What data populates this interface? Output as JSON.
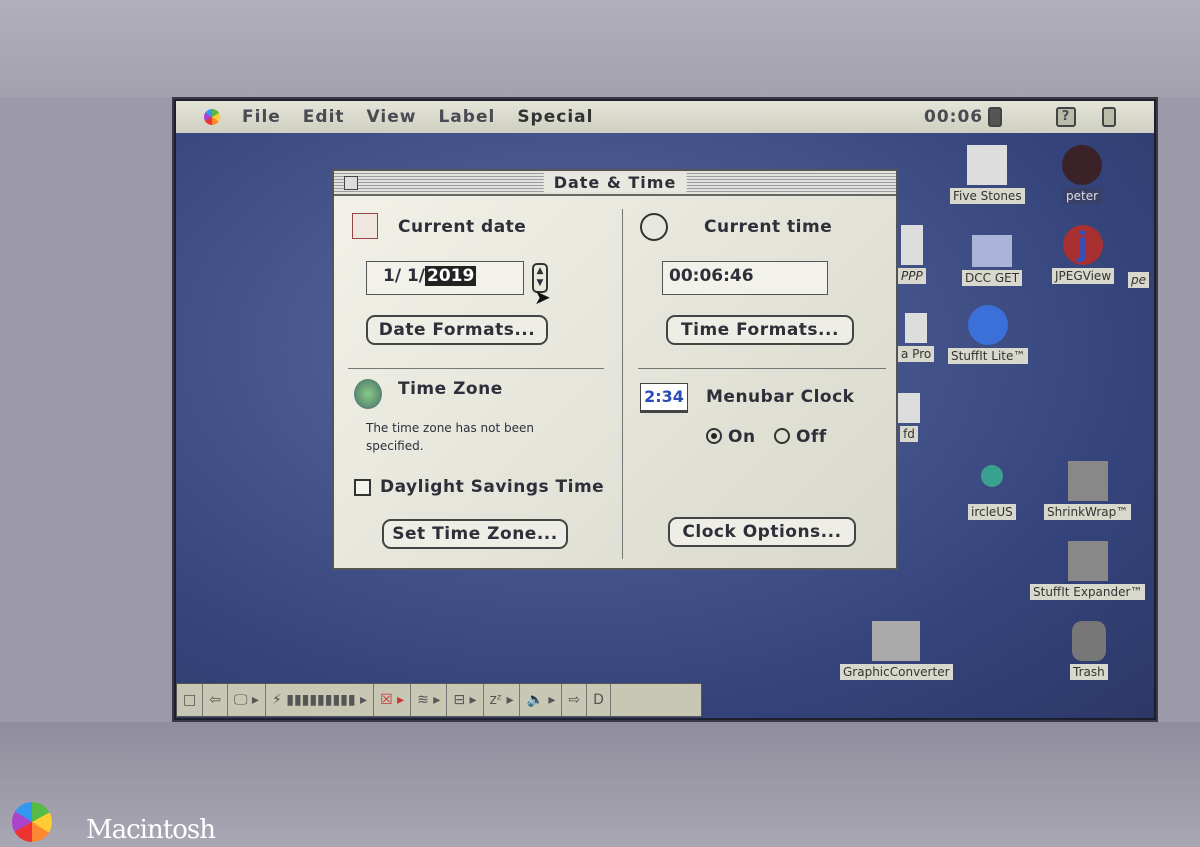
{
  "menubar": {
    "items": [
      "File",
      "Edit",
      "View",
      "Label",
      "Special"
    ],
    "clock": "00:06",
    "help_icon": "question-icon",
    "app_icon": "application-icon"
  },
  "dialog": {
    "title": "Date & Time",
    "current_date_label": "Current date",
    "date_prefix": "1/  1/",
    "date_year": "2019",
    "date_formats": "Date Formats...",
    "current_time_label": "Current time",
    "time_value": "00:06:46",
    "time_formats": "Time Formats...",
    "time_zone_label": "Time Zone",
    "time_zone_note": "The time zone has not been specified.",
    "dst_label": "Daylight Savings Time",
    "dst_checked": false,
    "set_time_zone": "Set Time Zone...",
    "menubar_clock_label": "Menubar Clock",
    "menubar_clock_icon_text": "2:34",
    "on_label": "On",
    "off_label": "Off",
    "clock_on": true,
    "clock_options": "Clock Options..."
  },
  "desktop_icons": [
    "Five Stones",
    "peter",
    "PPP",
    "DCC GET",
    "JPEGView",
    "pe",
    "a Pro",
    "StuffIt Lite™",
    "fd",
    "ircleUS",
    "ShrinkWrap™",
    "StuffIt Expander™",
    "GraphicConverter",
    "Trash"
  ],
  "brand": "Macintosh",
  "colors": {
    "desktop": "#3a4a80",
    "menubar": "#d8d8cc",
    "bezel": "#a09eaa"
  }
}
